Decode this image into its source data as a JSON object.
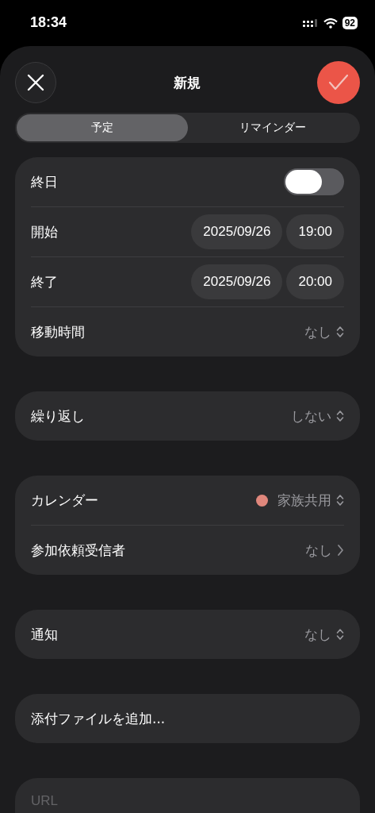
{
  "status_bar": {
    "time": "18:34",
    "battery": "92"
  },
  "header": {
    "title": "新規"
  },
  "segments": [
    {
      "label": "予定",
      "selected": true
    },
    {
      "label": "リマインダー",
      "selected": false
    }
  ],
  "groups": [
    {
      "rows": [
        {
          "kind": "toggle",
          "label": "終日",
          "on": false
        },
        {
          "kind": "datetime",
          "label": "開始",
          "date": "2025/09/26",
          "time": "19:00"
        },
        {
          "kind": "datetime",
          "label": "終了",
          "date": "2025/09/26",
          "time": "20:00"
        },
        {
          "kind": "picker",
          "label": "移動時間",
          "value": "なし"
        }
      ]
    },
    {
      "rows": [
        {
          "kind": "picker",
          "label": "繰り返し",
          "value": "しない"
        }
      ]
    },
    {
      "rows": [
        {
          "kind": "picker",
          "label": "カレンダー",
          "value": "家族共用",
          "color": "#e0877c"
        },
        {
          "kind": "link",
          "label": "参加依頼受信者",
          "value": "なし"
        }
      ]
    },
    {
      "rows": [
        {
          "kind": "picker",
          "label": "通知",
          "value": "なし"
        }
      ]
    },
    {
      "rows": [
        {
          "kind": "action",
          "label": "添付ファイルを追加..."
        }
      ]
    },
    {
      "rows": [
        {
          "kind": "field",
          "placeholder": "URL"
        }
      ]
    }
  ]
}
